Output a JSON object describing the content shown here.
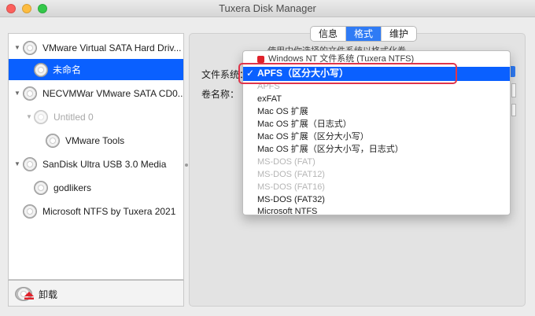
{
  "window": {
    "title": "Tuxera Disk Manager"
  },
  "sidebar": {
    "items": [
      {
        "label": "VMware Virtual SATA Hard Driv..."
      },
      {
        "label": "未命名"
      },
      {
        "label": "NECVMWar VMware SATA CD0..."
      },
      {
        "label": "Untitled 0"
      },
      {
        "label": "VMware Tools"
      },
      {
        "label": "SanDisk Ultra USB 3.0 Media"
      },
      {
        "label": "godlikers"
      },
      {
        "label": "Microsoft NTFS by Tuxera 2021"
      }
    ],
    "eject_label": "卸载"
  },
  "tabs": [
    "信息",
    "格式",
    "维护"
  ],
  "format": {
    "description": "使用中你选择的文件系统以格式化卷",
    "filesystem_label": "文件系统：",
    "volume_name_label": "卷名称："
  },
  "menu": {
    "items": [
      "Windows NT 文件系统 (Tuxera NTFS)",
      "APFS（区分大小写）",
      "APFS",
      "exFAT",
      "Mac OS 扩展",
      "Mac OS 扩展（日志式）",
      "Mac OS 扩展（区分大小写）",
      "Mac OS 扩展（区分大小写，日志式）",
      "MS-DOS (FAT)",
      "MS-DOS (FAT12)",
      "MS-DOS (FAT16)",
      "MS-DOS (FAT32)",
      "Microsoft NTFS"
    ],
    "check_mark": "✓"
  },
  "colors": {
    "accent": "#0a60ff",
    "annotation": "#e0344a"
  }
}
